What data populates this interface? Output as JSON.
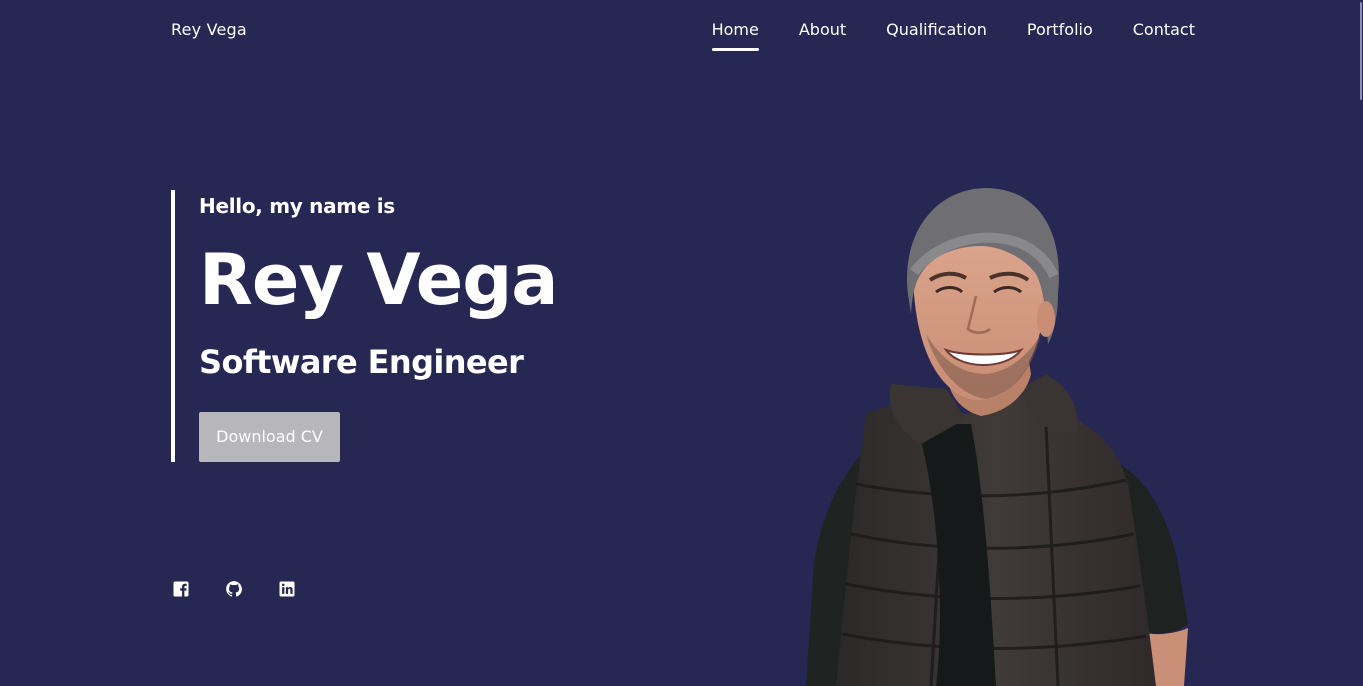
{
  "header": {
    "logo": "Rey Vega",
    "nav": [
      {
        "label": "Home",
        "active": true
      },
      {
        "label": "About",
        "active": false
      },
      {
        "label": "Qualification",
        "active": false
      },
      {
        "label": "Portfolio",
        "active": false
      },
      {
        "label": "Contact",
        "active": false
      }
    ]
  },
  "hero": {
    "greeting": "Hello, my name is",
    "name": "Rey Vega",
    "role": "Software Engineer",
    "cta_label": "Download CV"
  },
  "social": [
    {
      "icon": "facebook-icon"
    },
    {
      "icon": "github-icon"
    },
    {
      "icon": "linkedin-icon"
    }
  ],
  "colors": {
    "background": "#262752",
    "text": "#ffffff",
    "button": "#b7b7bb"
  }
}
